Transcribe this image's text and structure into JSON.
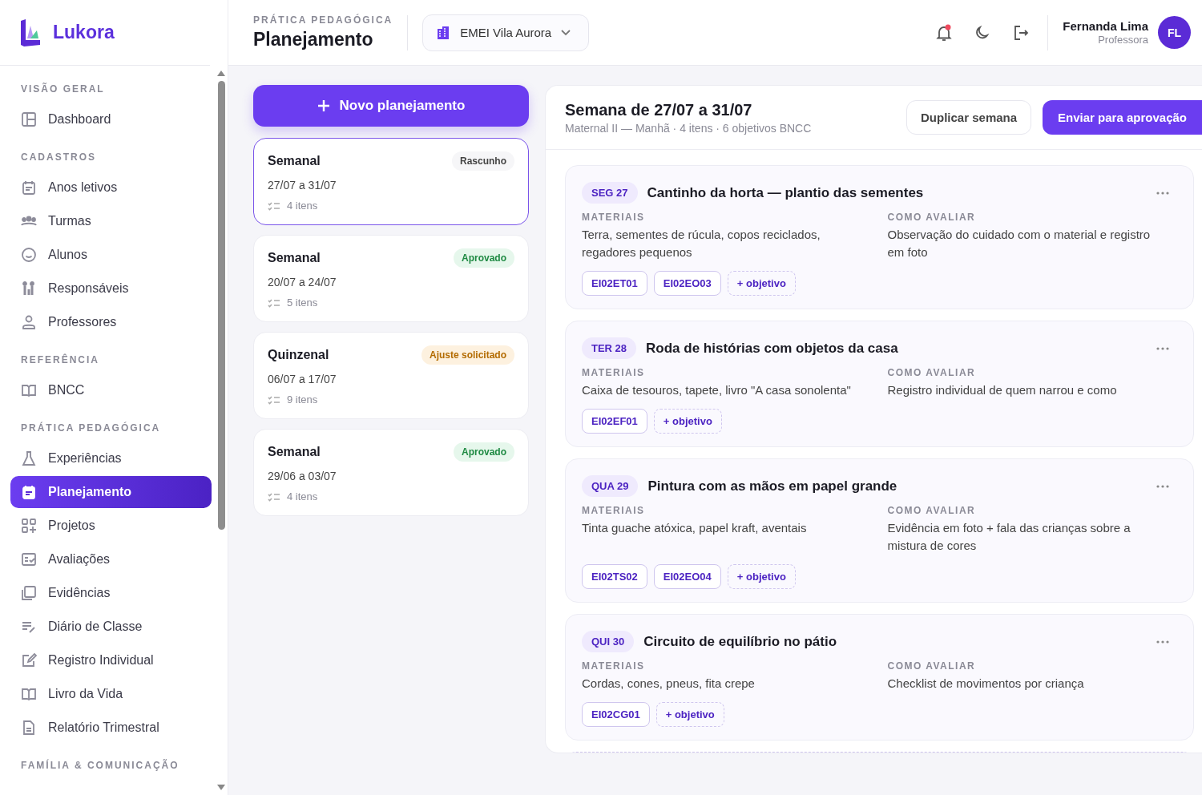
{
  "app": {
    "name": "Lukora"
  },
  "sidebar": {
    "sections": [
      {
        "title": "VISÃO GERAL",
        "items": [
          {
            "label": "Dashboard",
            "selected": false
          }
        ]
      },
      {
        "title": "CADASTROS",
        "items": [
          {
            "label": "Anos letivos",
            "selected": false
          },
          {
            "label": "Turmas",
            "selected": false
          },
          {
            "label": "Alunos",
            "selected": false
          },
          {
            "label": "Responsáveis",
            "selected": false
          },
          {
            "label": "Professores",
            "selected": false
          }
        ]
      },
      {
        "title": "REFERÊNCIA",
        "items": [
          {
            "label": "BNCC",
            "selected": false
          }
        ]
      },
      {
        "title": "PRÁTICA PEDAGÓGICA",
        "items": [
          {
            "label": "Experiências",
            "selected": false
          },
          {
            "label": "Planejamento",
            "selected": true
          },
          {
            "label": "Projetos",
            "selected": false
          },
          {
            "label": "Avaliações",
            "selected": false
          },
          {
            "label": "Evidências",
            "selected": false
          },
          {
            "label": "Diário de Classe",
            "selected": false
          },
          {
            "label": "Registro Individual",
            "selected": false
          },
          {
            "label": "Livro da Vida",
            "selected": false
          },
          {
            "label": "Relatório Trimestral",
            "selected": false
          }
        ]
      },
      {
        "title": "FAMÍLIA & COMUNICAÇÃO"
      }
    ]
  },
  "header": {
    "eyebrow": "PRÁTICA PEDAGÓGICA",
    "title": "Planejamento",
    "school": "EMEI Vila Aurora",
    "notifications": true,
    "user": {
      "name": "Fernanda Lima",
      "role": "Professora",
      "initials": "FL"
    }
  },
  "new_button": "Novo planejamento",
  "plans": [
    {
      "type": "Semanal",
      "dates": "27/07 a 31/07",
      "items": "4 itens",
      "status": "Rascunho",
      "kind": "draft",
      "selected": true
    },
    {
      "type": "Semanal",
      "dates": "20/07 a 24/07",
      "items": "5 itens",
      "status": "Aprovado",
      "kind": "approved",
      "selected": false
    },
    {
      "type": "Quinzenal",
      "dates": "06/07 a 17/07",
      "items": "9 itens",
      "status": "Ajuste solicitado",
      "kind": "adjust",
      "selected": false
    },
    {
      "type": "Semanal",
      "dates": "29/06 a 03/07",
      "items": "4 itens",
      "status": "Aprovado",
      "kind": "approved",
      "selected": false
    }
  ],
  "detail": {
    "title": "Semana de 27/07 a 31/07",
    "subtitle": "Maternal II — Manhã · 4 itens · 6 objetivos BNCC",
    "duplicate_button": "Duplicar semana",
    "submit_button": "Enviar para aprovação",
    "days": [
      {
        "day": "SEG 27",
        "title": "Cantinho da horta — plantio das sementes",
        "materials_label": "MATERIAIS",
        "materials": "Terra, sementes de rúcula, copos reciclados, regadores pequenos",
        "evaluation_label": "COMO AVALIAR",
        "evaluation": "Observação do cuidado com o material e registro em foto",
        "objectives": [
          "EI02ET01",
          "EI02EO03"
        ],
        "add_objective": "+ objetivo"
      },
      {
        "day": "TER 28",
        "title": "Roda de histórias com objetos da casa",
        "materials_label": "MATERIAIS",
        "materials": "Caixa de tesouros, tapete, livro \"A casa sonolenta\"",
        "evaluation_label": "COMO AVALIAR",
        "evaluation": "Registro individual de quem narrou e como",
        "objectives": [
          "EI02EF01"
        ],
        "add_objective": "+ objetivo"
      },
      {
        "day": "QUA 29",
        "title": "Pintura com as mãos em papel grande",
        "materials_label": "MATERIAIS",
        "materials": "Tinta guache atóxica, papel kraft, aventais",
        "evaluation_label": "COMO AVALIAR",
        "evaluation": "Evidência em foto + fala das crianças sobre a mistura de cores",
        "objectives": [
          "EI02TS02",
          "EI02EO04"
        ],
        "add_objective": "+ objetivo"
      },
      {
        "day": "QUI 30",
        "title": "Circuito de equilíbrio no pátio",
        "materials_label": "MATERIAIS",
        "materials": "Cordas, cones, pneus, fita crepe",
        "evaluation_label": "COMO AVALIAR",
        "evaluation": "Checklist de movimentos por criança",
        "objectives": [
          "EI02CG01"
        ],
        "add_objective": "+ objetivo"
      }
    ]
  }
}
